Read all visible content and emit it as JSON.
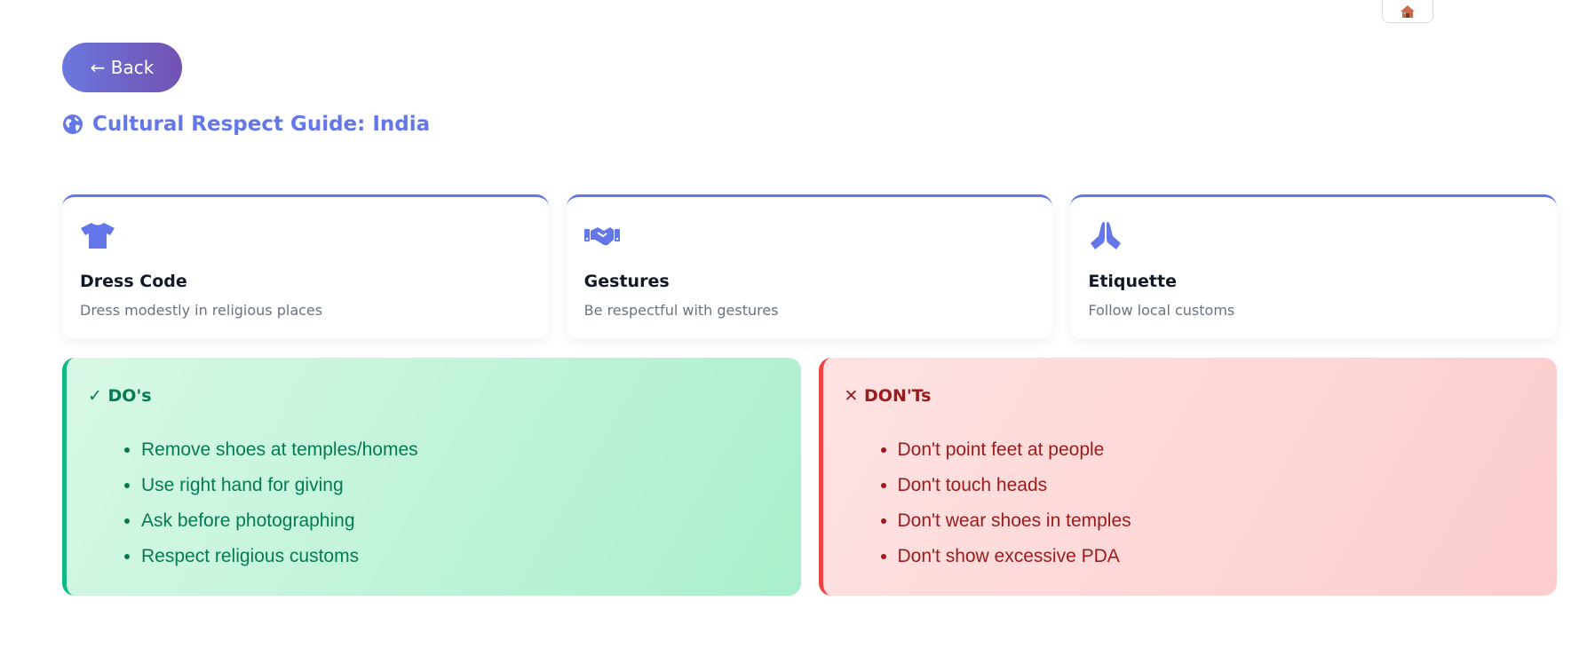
{
  "header": {
    "home_icon": "house-emoji-icon",
    "back_label": "← Back",
    "title_icon": "globe-icon",
    "title": "Cultural Respect Guide: India"
  },
  "cards": [
    {
      "icon": "tshirt-icon",
      "title": "Dress Code",
      "desc": "Dress modestly in religious places"
    },
    {
      "icon": "handshake-icon",
      "title": "Gestures",
      "desc": "Be respectful with gestures"
    },
    {
      "icon": "praying-hands-icon",
      "title": "Etiquette",
      "desc": "Follow local customs"
    }
  ],
  "dos": {
    "heading": "✓ DO's",
    "items": [
      "Remove shoes at temples/homes",
      "Use right hand for giving",
      "Ask before photographing",
      "Respect religious customs"
    ]
  },
  "donts": {
    "heading": "✕ DON'Ts",
    "items": [
      "Don't point feet at people",
      "Don't touch heads",
      "Don't wear shoes in temples",
      "Don't show excessive PDA"
    ]
  },
  "colors": {
    "accent": "#6477e8",
    "dos_border": "#10b981",
    "dos_text": "#057a55",
    "donts_border": "#ef4444",
    "donts_text": "#991b1b"
  }
}
